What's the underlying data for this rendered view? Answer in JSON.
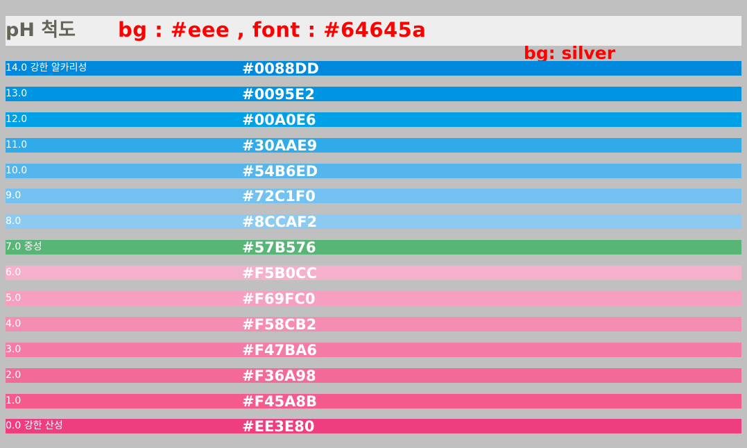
{
  "header": {
    "title": "pH 척도",
    "annotation": "bg : #eee , font : #64645a",
    "bg_color": "#eeeeee",
    "font_color": "#64645a"
  },
  "page": {
    "annotation": "bg: silver",
    "bg_color": "#c0c0c0"
  },
  "scale": {
    "rows": [
      {
        "label": "14.0 강한 알카리성",
        "hex": "#0088DD",
        "color": "#0088DD"
      },
      {
        "label": "13.0",
        "hex": "#0095E2",
        "color": "#0095E2"
      },
      {
        "label": "12.0",
        "hex": "#00A0E6",
        "color": "#00A0E6"
      },
      {
        "label": "11.0",
        "hex": "#30AAE9",
        "color": "#30AAE9"
      },
      {
        "label": "10.0",
        "hex": "#54B6ED",
        "color": "#54B6ED"
      },
      {
        "label": "9.0",
        "hex": "#72C1F0",
        "color": "#72C1F0"
      },
      {
        "label": "8.0",
        "hex": "#8CCAF2",
        "color": "#8CCAF2"
      },
      {
        "label": "7.0 중성",
        "hex": "#57B576",
        "color": "#57B576"
      },
      {
        "label": "6.0",
        "hex": "#F5B0CC",
        "color": "#F5B0CC"
      },
      {
        "label": "5.0",
        "hex": "#F69FC0",
        "color": "#F69FC0"
      },
      {
        "label": "4.0",
        "hex": "#F58CB2",
        "color": "#F58CB2"
      },
      {
        "label": "3.0",
        "hex": "#F47BA6",
        "color": "#F47BA6"
      },
      {
        "label": "2.0",
        "hex": "#F36A98",
        "color": "#F36A98"
      },
      {
        "label": "1.0",
        "hex": "#F45A8B",
        "color": "#F45A8B"
      },
      {
        "label": "0.0 강한 산성",
        "hex": "#EE3E80",
        "color": "#EE3E80"
      }
    ]
  },
  "annotation_color": "#ff0000"
}
